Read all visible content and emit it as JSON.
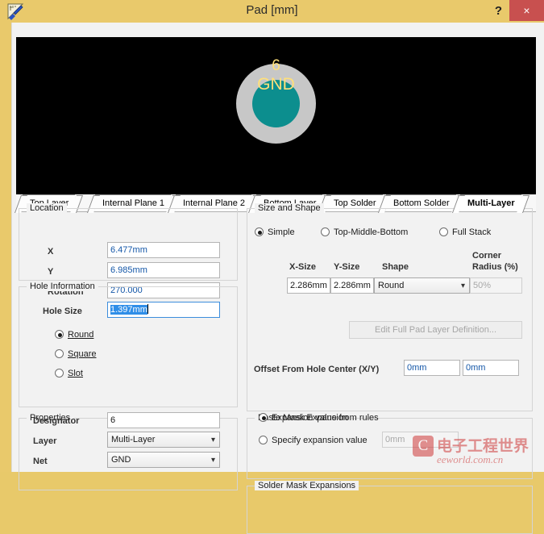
{
  "window": {
    "title": "Pad [mm]",
    "icon": "pad-tool-icon",
    "help_label": "?",
    "close_label": "×",
    "titlebar_color": "#e9c96b",
    "close_color": "#c8504f"
  },
  "preview": {
    "background": "#000000",
    "pad_outer_color": "#c7c7c7",
    "pad_inner_color": "#0c8e8e",
    "pad_text_color": "#ffe07a",
    "designator": "6",
    "net": "GND"
  },
  "layer_tabs": [
    {
      "label": "Top Layer",
      "active": false
    },
    {
      "label": "Internal Plane 1",
      "active": false
    },
    {
      "label": "Internal Plane 2",
      "active": false
    },
    {
      "label": "Bottom Layer",
      "active": false
    },
    {
      "label": "Top Solder",
      "active": false
    },
    {
      "label": "Bottom Solder",
      "active": false
    },
    {
      "label": "Multi-Layer",
      "active": true
    }
  ],
  "location": {
    "title": "Location",
    "x_label": "X",
    "x_value": "6.477mm",
    "y_label": "Y",
    "y_value": "6.985mm",
    "rotation_label": "Rotation",
    "rotation_value": "270.000"
  },
  "hole_information": {
    "title": "Hole Information",
    "hole_size_label": "Hole Size",
    "hole_size_value": "1.397mm",
    "hole_size_selected": true,
    "shapes": [
      {
        "label": "Round",
        "selected": true
      },
      {
        "label": "Square",
        "selected": false
      },
      {
        "label": "Slot",
        "selected": false
      }
    ]
  },
  "properties": {
    "title": "Properties",
    "designator_label": "Designator",
    "designator_value": "6",
    "layer_label": "Layer",
    "layer_value": "Multi-Layer",
    "net_label": "Net",
    "net_value": "GND"
  },
  "size_and_shape": {
    "title": "Size and Shape",
    "modes": [
      {
        "label": "Simple",
        "selected": true
      },
      {
        "label": "Top-Middle-Bottom",
        "selected": false
      },
      {
        "label": "Full Stack",
        "selected": false
      }
    ],
    "columns": {
      "x_size": "X-Size",
      "y_size": "Y-Size",
      "shape": "Shape",
      "corner_radius_l1": "Corner",
      "corner_radius_l2": "Radius (%)"
    },
    "row": {
      "x_size": "2.286mm",
      "y_size": "2.286mm",
      "shape": "Round",
      "corner_radius": "50%"
    },
    "edit_full_pad_button": "Edit Full Pad Layer Definition...",
    "edit_full_pad_enabled": false,
    "offset_label": "Offset From Hole Center (X/Y)",
    "offset_x": "0mm",
    "offset_y": "0mm"
  },
  "paste_mask_expansion": {
    "title": "Paste Mask Expansion",
    "option_from_rules": "Expansion value from rules",
    "option_specify": "Specify expansion value",
    "from_rules_selected": true,
    "specify_value": "0mm"
  },
  "solder_mask_expansions": {
    "title": "Solder Mask Expansions"
  },
  "watermark": {
    "logo_glyph": "C",
    "chinese": "电子工程世界",
    "english": "eeworld.com.cn",
    "color": "#cf3a3a"
  }
}
